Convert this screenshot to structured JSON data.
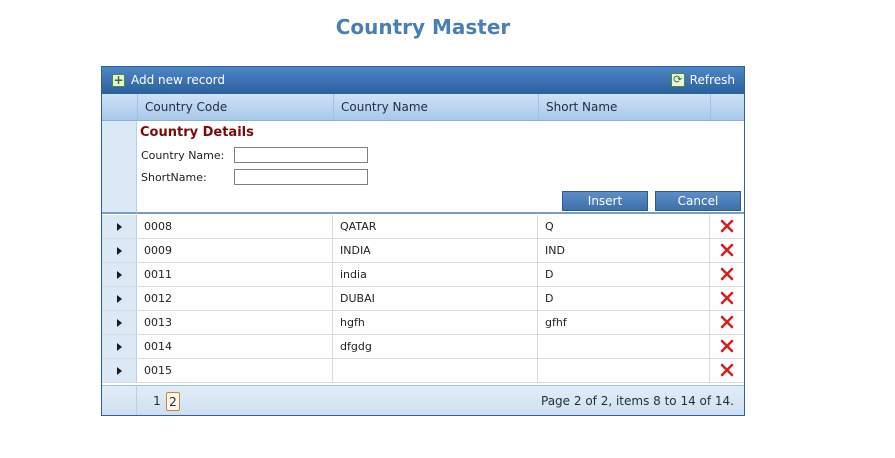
{
  "page": {
    "title": "Country Master"
  },
  "toolbar": {
    "add_label": "Add new record",
    "refresh_label": "Refresh"
  },
  "columns": {
    "code": "Country Code",
    "name": "Country Name",
    "short": "Short Name"
  },
  "edit_form": {
    "title": "Country Details",
    "country_name_label": "Country Name:",
    "country_name_value": "",
    "short_name_label": "ShortName:",
    "short_name_value": "",
    "insert_label": "Insert",
    "cancel_label": "Cancel"
  },
  "rows": [
    {
      "code": "0008",
      "name": "QATAR",
      "short": "Q"
    },
    {
      "code": "0009",
      "name": "INDIA",
      "short": "IND"
    },
    {
      "code": "0011",
      "name": "india",
      "short": "D"
    },
    {
      "code": "0012",
      "name": "DUBAI",
      "short": "D"
    },
    {
      "code": "0013",
      "name": "hgfh",
      "short": "gfhf"
    },
    {
      "code": "0014",
      "name": "dfgdg",
      "short": ""
    },
    {
      "code": "0015",
      "name": "",
      "short": ""
    }
  ],
  "pager": {
    "pages": [
      "1",
      "2"
    ],
    "current_page": "2",
    "info": "Page 2 of 2, items 8 to 14 of 14."
  },
  "colors": {
    "accent": "#4a7fb5",
    "header_bar": "#2b5f9d",
    "form_title": "#7a0a0a",
    "delete": "#d42020"
  },
  "icons": {
    "add": "plus-icon",
    "refresh": "refresh-icon",
    "expand": "expand-arrow-icon",
    "delete": "delete-x-icon"
  }
}
